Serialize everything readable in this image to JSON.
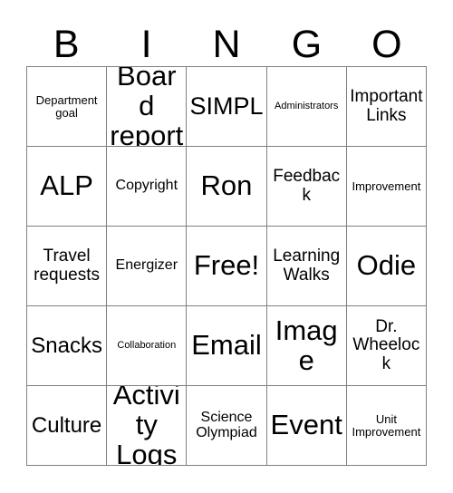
{
  "card": {
    "header_letters": [
      "B",
      "I",
      "N",
      "G",
      "O"
    ],
    "free_space_label": "Free!",
    "grid_size": "5x5",
    "colors": {
      "border": "#808080",
      "text": "#000000",
      "background": "#ffffff"
    },
    "rows": [
      [
        {
          "label": "Department goal",
          "size": "xs"
        },
        {
          "label": "Board report",
          "size": "xxl"
        },
        {
          "label": "SIMPL",
          "size": "xl"
        },
        {
          "label": "Administrators",
          "size": "xxs"
        },
        {
          "label": "Important Links",
          "size": "md"
        }
      ],
      [
        {
          "label": "ALP",
          "size": "xxl"
        },
        {
          "label": "Copyright",
          "size": "sm"
        },
        {
          "label": "Ron",
          "size": "xxl"
        },
        {
          "label": "Feedback",
          "size": "md"
        },
        {
          "label": "Improvement",
          "size": "xs"
        }
      ],
      [
        {
          "label": "Travel requests",
          "size": "md"
        },
        {
          "label": "Energizer",
          "size": "sm"
        },
        {
          "label": "Free!",
          "size": "xxl"
        },
        {
          "label": "Learning Walks",
          "size": "md"
        },
        {
          "label": "Odie",
          "size": "xxl"
        }
      ],
      [
        {
          "label": "Snacks",
          "size": "lg"
        },
        {
          "label": "Collaboration",
          "size": "xxs"
        },
        {
          "label": "Email",
          "size": "xxl"
        },
        {
          "label": "Image",
          "size": "xxl"
        },
        {
          "label": "Dr. Wheelock",
          "size": "md"
        }
      ],
      [
        {
          "label": "Culture",
          "size": "lg"
        },
        {
          "label": "Activity Logs",
          "size": "xxl"
        },
        {
          "label": "Science Olympiad",
          "size": "sm"
        },
        {
          "label": "Event",
          "size": "xxl"
        },
        {
          "label": "Unit Improvement",
          "size": "xs"
        }
      ]
    ]
  }
}
